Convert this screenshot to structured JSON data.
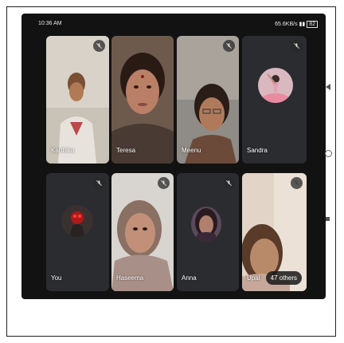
{
  "status_bar": {
    "time": "10:36 AM",
    "network": "65.6KB/s",
    "battery": "82"
  },
  "participants": [
    {
      "name": "Karthika",
      "muted": true,
      "type": "video"
    },
    {
      "name": "Teresa",
      "muted": false,
      "type": "video"
    },
    {
      "name": "Meenu",
      "muted": true,
      "type": "video"
    },
    {
      "name": "Sandra",
      "muted": true,
      "type": "avatar"
    },
    {
      "name": "You",
      "muted": true,
      "type": "avatar"
    },
    {
      "name": "Haseema",
      "muted": true,
      "type": "video"
    },
    {
      "name": "Anna",
      "muted": true,
      "type": "avatar"
    },
    {
      "name": "Upal",
      "muted": true,
      "type": "video"
    }
  ],
  "others_label": "47 others",
  "icons": {
    "mute": "mic-off-icon",
    "back": "back-triangle-icon",
    "home": "home-circle-icon",
    "recent": "recent-apps-icon"
  },
  "colors": {
    "tile_bg": "#2b2c2f",
    "screen_bg": "#121212"
  }
}
